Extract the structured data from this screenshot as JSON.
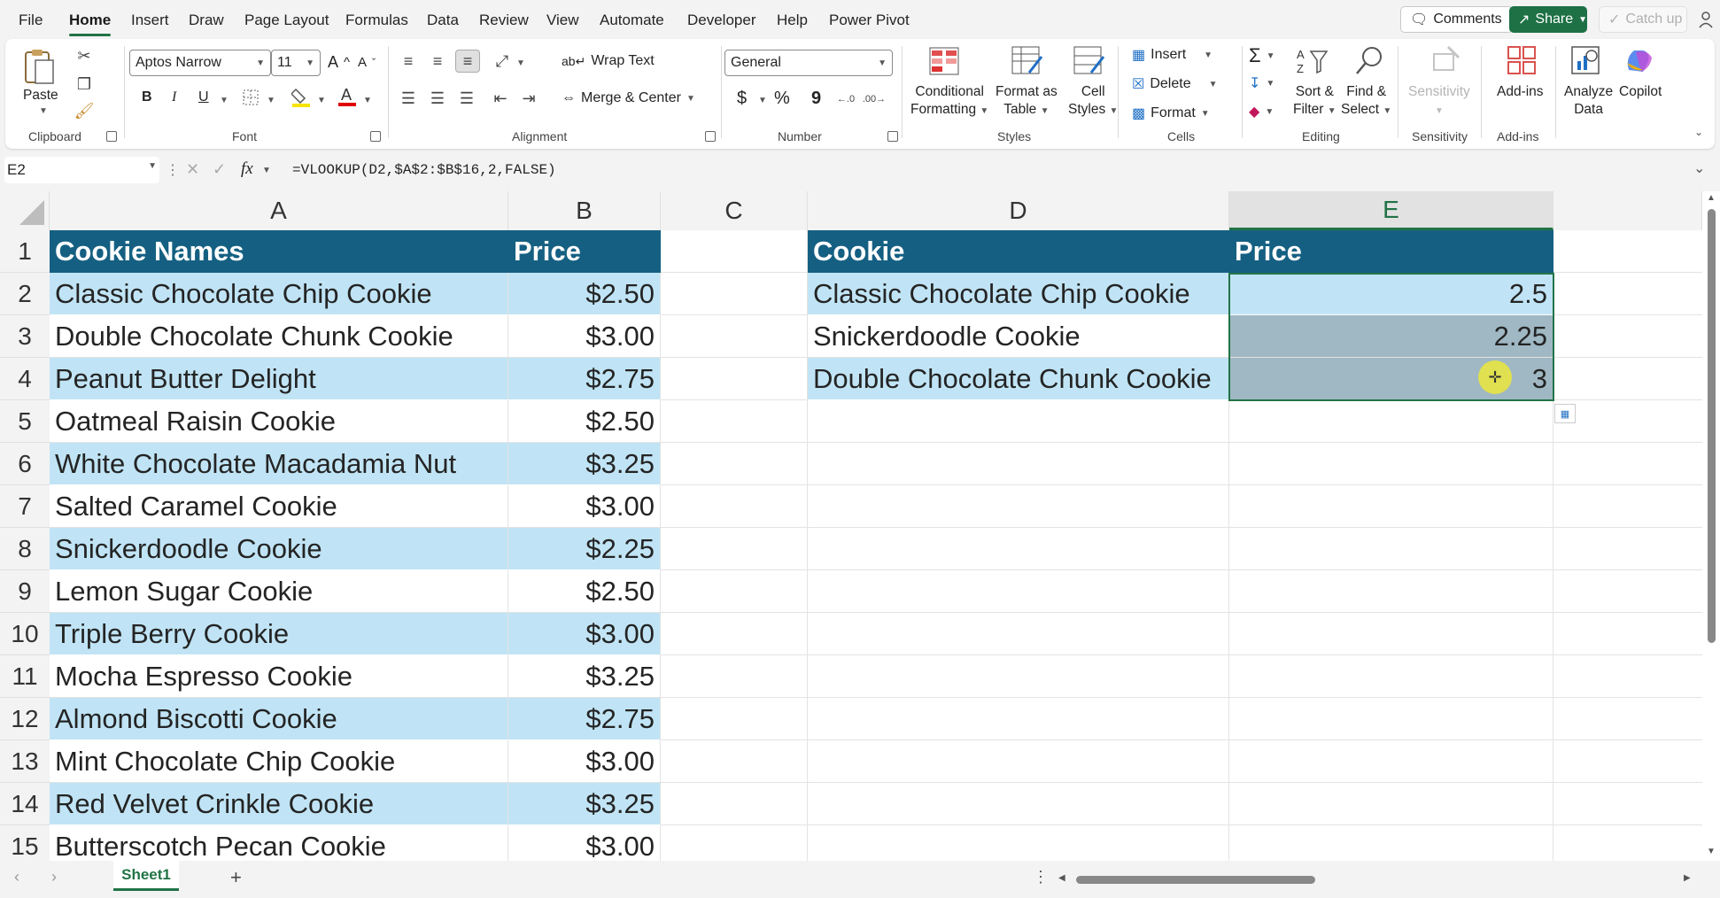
{
  "menu": {
    "items": [
      "File",
      "Home",
      "Insert",
      "Draw",
      "Page Layout",
      "Formulas",
      "Data",
      "Review",
      "View",
      "Automate",
      "Developer",
      "Help",
      "Power Pivot"
    ],
    "active": "Home",
    "comments": "Comments",
    "share": "Share",
    "catch_up": "Catch up"
  },
  "ribbon": {
    "clipboard": {
      "paste": "Paste",
      "label": "Clipboard"
    },
    "font": {
      "name": "Aptos Narrow",
      "size": "11",
      "label": "Font",
      "bold": "B",
      "italic": "I",
      "underline": "U",
      "grow": "A",
      "shrink": "A"
    },
    "alignment": {
      "wrap": "Wrap Text",
      "merge": "Merge & Center",
      "label": "Alignment"
    },
    "number": {
      "format": "General",
      "label": "Number",
      "currency": "$",
      "percent": "%",
      "comma": "9"
    },
    "styles": {
      "conditional_1": "Conditional",
      "conditional_2": "Formatting",
      "table_1": "Format as",
      "table_2": "Table",
      "cell_1": "Cell",
      "cell_2": "Styles",
      "label": "Styles"
    },
    "cells": {
      "insert": "Insert",
      "delete": "Delete",
      "format": "Format",
      "label": "Cells"
    },
    "editing": {
      "sort_1": "Sort &",
      "sort_2": "Filter",
      "find_1": "Find &",
      "find_2": "Select",
      "label": "Editing",
      "sum": "Σ"
    },
    "sensitivity": {
      "button": "Sensitivity",
      "label": "Sensitivity"
    },
    "addins": {
      "button": "Add-ins",
      "label": "Add-ins"
    },
    "analyze_1": "Analyze",
    "analyze_2": "Data",
    "copilot": "Copilot"
  },
  "formula_bar": {
    "name_box": "E2",
    "fx": "fx",
    "formula": "=VLOOKUP(D2,$A$2:$B$16,2,FALSE)"
  },
  "columns": [
    "A",
    "B",
    "C",
    "D",
    "E"
  ],
  "rows": [
    "1",
    "2",
    "3",
    "4",
    "5",
    "6",
    "7",
    "8",
    "9",
    "10",
    "11",
    "12",
    "13",
    "14",
    "15"
  ],
  "table1": {
    "headers": [
      "Cookie Names",
      "Price"
    ],
    "rows": [
      [
        "Classic Chocolate Chip Cookie",
        "$2.50"
      ],
      [
        "Double Chocolate Chunk Cookie",
        "$3.00"
      ],
      [
        "Peanut Butter Delight",
        "$2.75"
      ],
      [
        "Oatmeal Raisin Cookie",
        "$2.50"
      ],
      [
        "White Chocolate Macadamia Nut",
        "$3.25"
      ],
      [
        "Salted Caramel Cookie",
        "$3.00"
      ],
      [
        "Snickerdoodle Cookie",
        "$2.25"
      ],
      [
        "Lemon Sugar Cookie",
        "$2.50"
      ],
      [
        "Triple Berry Cookie",
        "$3.00"
      ],
      [
        "Mocha Espresso Cookie",
        "$3.25"
      ],
      [
        "Almond Biscotti Cookie",
        "$2.75"
      ],
      [
        "Mint Chocolate Chip Cookie",
        "$3.00"
      ],
      [
        "Red Velvet Crinkle Cookie",
        "$3.25"
      ],
      [
        "Butterscotch Pecan Cookie",
        "$3.00"
      ]
    ]
  },
  "table2": {
    "headers": [
      "Cookie",
      "Price"
    ],
    "rows": [
      [
        "Classic Chocolate Chip Cookie",
        "2.5"
      ],
      [
        "Snickerdoodle Cookie",
        "2.25"
      ],
      [
        "Double Chocolate Chunk Cookie",
        "3"
      ]
    ]
  },
  "sheet_tab": "Sheet1",
  "colors": {
    "header": "#156082",
    "band": "#c0e4f5",
    "accent": "#217346"
  }
}
